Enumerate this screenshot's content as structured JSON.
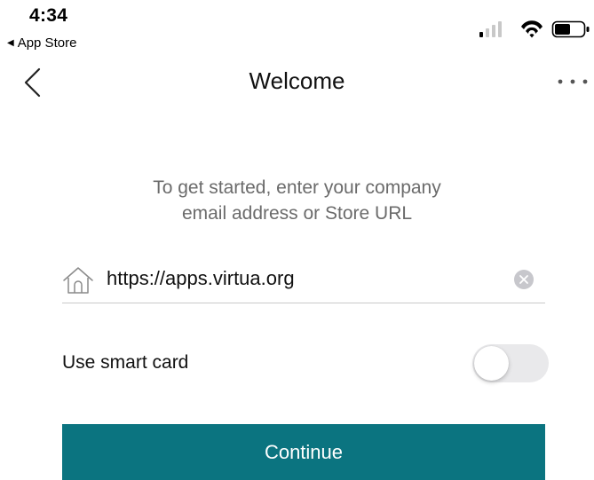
{
  "status_bar": {
    "time": "4:34",
    "back_label": "App Store",
    "icons": [
      "cellular-signal-icon",
      "wifi-icon",
      "battery-icon"
    ]
  },
  "nav": {
    "title": "Welcome",
    "back_icon": "chevron-left-icon",
    "more_icon": "more-horizontal-icon"
  },
  "intro": {
    "line1": "To get started, enter your company",
    "line2": "email address or Store URL"
  },
  "url_field": {
    "value": "https://apps.virtua.org",
    "icon": "home-icon",
    "clear_icon": "clear-circle-icon"
  },
  "smart_card": {
    "label": "Use smart card",
    "enabled": false
  },
  "continue_button": {
    "label": "Continue"
  },
  "colors": {
    "accent": "#0b7480",
    "intro_text": "#6b6b6b",
    "toggle_off": "#e9e9eb",
    "divider": "#c9c9c9"
  }
}
